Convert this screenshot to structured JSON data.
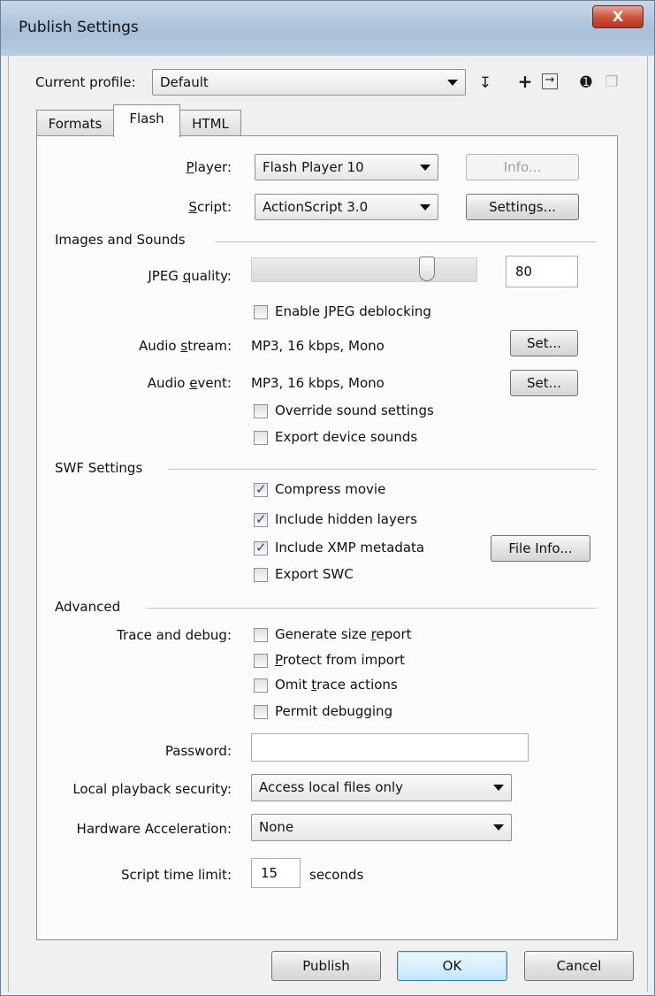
{
  "window": {
    "title": "Publish Settings",
    "close_glyph": "X"
  },
  "profile": {
    "label": "Current profile:",
    "value": "Default"
  },
  "toolbar_icons": [
    "import-export-icon",
    "add-profile-icon",
    "duplicate-profile-icon",
    "profile-info-icon",
    "delete-profile-icon"
  ],
  "tabs": [
    {
      "label": "Formats",
      "selected": false
    },
    {
      "label": "Flash",
      "selected": true
    },
    {
      "label": "HTML",
      "selected": false
    }
  ],
  "player": {
    "label": "Player:",
    "value": "Flash Player 10",
    "info_button": "Info..."
  },
  "script": {
    "label": "Script:",
    "value": "ActionScript 3.0",
    "settings_button": "Settings..."
  },
  "images_sounds": {
    "heading": "Images and Sounds",
    "jpeg_quality_label": "JPEG quality:",
    "jpeg_quality_value": "80",
    "jpeg_quality_level": 80,
    "jpeg_deblocking": {
      "label": "Enable JPEG deblocking",
      "checked": false
    },
    "audio_stream": {
      "label": "Audio stream:",
      "value": "MP3, 16 kbps, Mono",
      "button": "Set..."
    },
    "audio_event": {
      "label": "Audio event:",
      "value": "MP3, 16 kbps, Mono",
      "button": "Set..."
    },
    "override_sound": {
      "label": "Override sound settings",
      "checked": false
    },
    "export_device_sounds": {
      "label": "Export device sounds",
      "checked": false
    }
  },
  "swf": {
    "heading": "SWF Settings",
    "compress_movie": {
      "label": "Compress movie",
      "checked": true
    },
    "include_hidden_layers": {
      "label": "Include hidden layers",
      "checked": true
    },
    "include_xmp": {
      "label": "Include XMP metadata",
      "checked": true
    },
    "file_info_button": "File Info...",
    "export_swc": {
      "label": "Export SWC",
      "checked": false
    }
  },
  "advanced": {
    "heading": "Advanced",
    "trace_label": "Trace and debug:",
    "size_report": {
      "label": "Generate size report",
      "checked": false
    },
    "protect_import": {
      "label": "Protect from import",
      "checked": false
    },
    "omit_trace": {
      "label": "Omit trace actions",
      "checked": false
    },
    "permit_debugging": {
      "label": "Permit debugging",
      "checked": false
    },
    "password_label": "Password:",
    "password_value": "",
    "local_security_label": "Local playback security:",
    "local_security_value": "Access local files only",
    "hw_accel_label": "Hardware Acceleration:",
    "hw_accel_value": "None",
    "time_limit_label": "Script time limit:",
    "time_limit_value": "15",
    "time_limit_unit": "seconds"
  },
  "buttons": {
    "publish": "Publish",
    "ok": "OK",
    "cancel": "Cancel"
  }
}
